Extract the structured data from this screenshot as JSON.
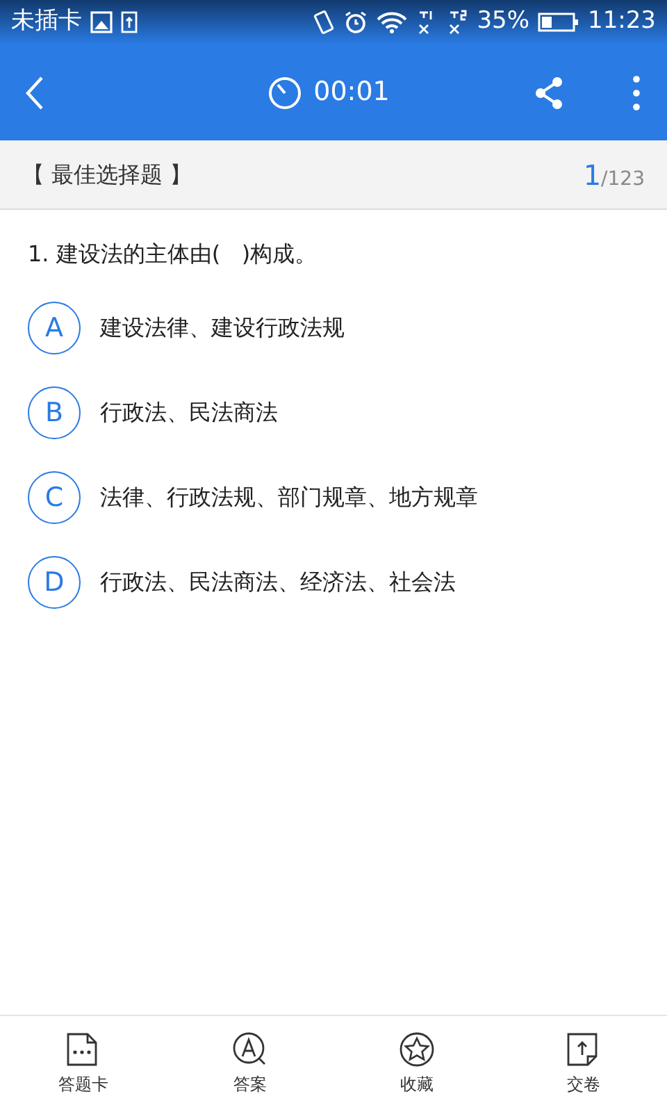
{
  "status_bar": {
    "carrier": "未插卡",
    "battery": "35%",
    "time": "11:23"
  },
  "toolbar": {
    "timer": "00:01"
  },
  "section": {
    "title": "【 最佳选择题 】",
    "current": "1",
    "total": "/123"
  },
  "question": {
    "text": "1. 建设法的主体由(   )构成。",
    "options": [
      {
        "letter": "A",
        "text": "建设法律、建设行政法规",
        "selected": false
      },
      {
        "letter": "B",
        "text": "行政法、民法商法",
        "selected": false
      },
      {
        "letter": "C",
        "text": "法律、行政法规、部门规章、地方规章",
        "selected": false
      },
      {
        "letter": "D",
        "text": "行政法、民法商法、经济法、社会法",
        "selected": false
      }
    ]
  },
  "bottom_nav": [
    {
      "kind": "card",
      "label": "答题卡"
    },
    {
      "kind": "answer",
      "label": "答案"
    },
    {
      "kind": "favorite",
      "label": "收藏"
    },
    {
      "kind": "submit",
      "label": "交卷"
    }
  ]
}
